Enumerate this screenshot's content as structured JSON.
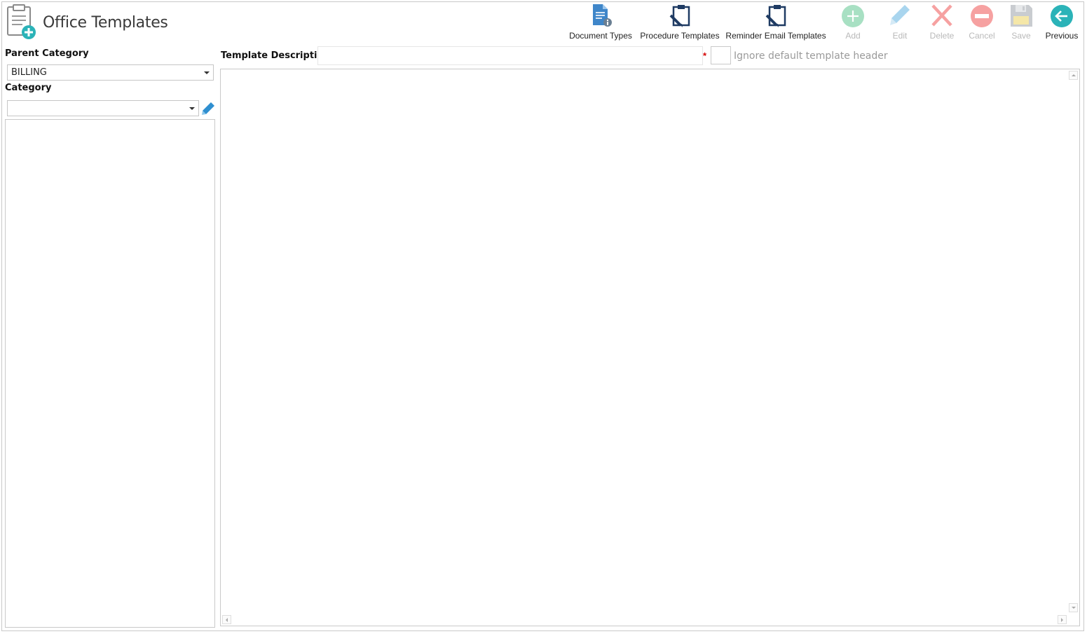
{
  "app": {
    "title": "Office Templates",
    "icon": "template-add-icon"
  },
  "toolbar": {
    "document_types": "Document Types",
    "procedure_templates": "Procedure Templates",
    "reminder_email_templates": "Reminder Email Templates",
    "add": "Add",
    "edit": "Edit",
    "delete": "Delete",
    "cancel": "Cancel",
    "save": "Save",
    "previous": "Previous"
  },
  "left": {
    "parent_category_label": "Parent Category",
    "parent_category_value": "BILLING",
    "category_label": "Category",
    "category_value": ""
  },
  "form": {
    "template_description_label": "Template Description",
    "template_description_value": "",
    "required_marker": "*",
    "ignore_header_label": "Ignore default template header",
    "ignore_header_checked": false
  },
  "colors": {
    "accent_teal": "#2bb3b8",
    "navy": "#1f3b63",
    "disabled_green": "#a8e0c3",
    "disabled_red": "#f6a1a1",
    "disabled_blue": "#a9d5ee",
    "required_red": "#d40000"
  }
}
